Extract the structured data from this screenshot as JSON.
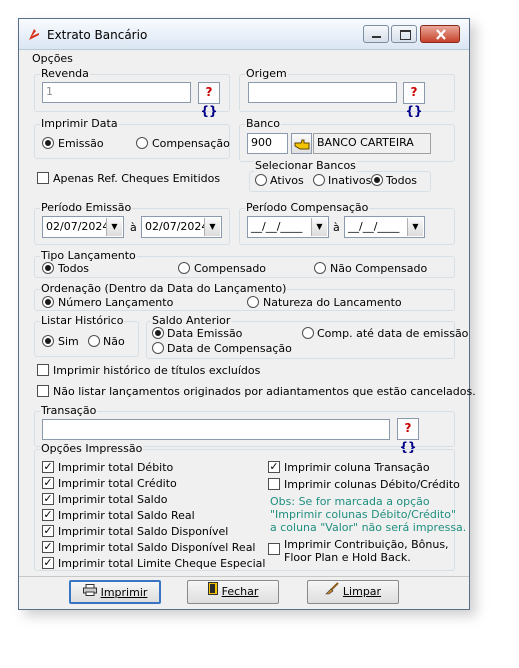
{
  "window": {
    "title": "Extrato Bancário"
  },
  "opcoes": {
    "title": "Opções"
  },
  "revenda": {
    "title": "Revenda",
    "value": "1",
    "help": "?",
    "help2": "{}"
  },
  "origem": {
    "title": "Origem",
    "value": "",
    "help": "?",
    "help2": "{}"
  },
  "imprimir_data": {
    "title": "Imprimir Data",
    "options": [
      "Emissão",
      "Compensação"
    ],
    "selected": "Emissão"
  },
  "banco": {
    "title": "Banco",
    "code": "900",
    "name": "BANCO CARTEIRA"
  },
  "apenas_ref": {
    "label": "Apenas Ref. Cheques Emitidos",
    "checked": false
  },
  "selecionar_bancos": {
    "title": "Selecionar Bancos",
    "options": [
      "Ativos",
      "Inativos",
      "Todos"
    ],
    "selected": "Todos"
  },
  "periodo_emissao": {
    "title": "Período Emissão",
    "from": "02/07/2024",
    "sep": "à",
    "to": "02/07/2024"
  },
  "periodo_compensacao": {
    "title": "Período Compensação",
    "from": "__/__/____",
    "sep": "à",
    "to": "__/__/____"
  },
  "tipo_lancamento": {
    "title": "Tipo Lançamento",
    "options": [
      "Todos",
      "Compensado",
      "Não Compensado"
    ],
    "selected": "Todos"
  },
  "ordenacao": {
    "title": "Ordenação (Dentro da Data do Lançamento)",
    "options": [
      "Número Lançamento",
      "Natureza do Lancamento"
    ],
    "selected": "Número Lançamento"
  },
  "listar_historico": {
    "title": "Listar Histórico",
    "options": [
      "Sim",
      "Não"
    ],
    "selected": "Sim"
  },
  "saldo_anterior": {
    "title": "Saldo Anterior",
    "options": [
      "Data Emissão",
      "Comp. até data de emissão",
      "Data de Compensação"
    ],
    "selected": "Data Emissão"
  },
  "imprimir_historico": {
    "label": "Imprimir histórico de títulos excluídos",
    "checked": false
  },
  "nao_listar": {
    "label": "Não listar lançamentos originados por adiantamentos que estão cancelados.",
    "checked": false
  },
  "transacao": {
    "title": "Transação",
    "value": "",
    "help": "?",
    "help2": "{}"
  },
  "opcoes_impressao": {
    "title": "Opções Impressão",
    "left": [
      {
        "label": "Imprimir total Débito",
        "checked": true
      },
      {
        "label": "Imprimir total Crédito",
        "checked": true
      },
      {
        "label": "Imprimir total Saldo",
        "checked": true
      },
      {
        "label": "Imprimir total Saldo Real",
        "checked": true
      },
      {
        "label": "Imprimir total Saldo Disponível",
        "checked": true
      },
      {
        "label": "Imprimir total Saldo Disponível Real",
        "checked": true
      },
      {
        "label": "Imprimir total Limite Cheque Especial",
        "checked": true
      }
    ],
    "right": [
      {
        "label": "Imprimir coluna Transação",
        "checked": true
      },
      {
        "label": "Imprimir colunas Débito/Crédito",
        "checked": false
      }
    ],
    "note": [
      "Obs: Se for marcada a opção",
      "\"Imprimir colunas Débito/Crédito\"",
      "a coluna \"Valor\" não será impressa."
    ],
    "contribuicao": {
      "label_line1": "Imprimir Contribuição, Bônus,",
      "label_line2": "Floor Plan e Hold Back.",
      "checked": false
    }
  },
  "buttons": {
    "imprimir": "Imprimir",
    "fechar": "Fechar",
    "limpar": "Limpar"
  },
  "colors": {
    "note": "#1f8f7f",
    "help_red": "#cc0000",
    "focus_border": "#3a75c4"
  }
}
